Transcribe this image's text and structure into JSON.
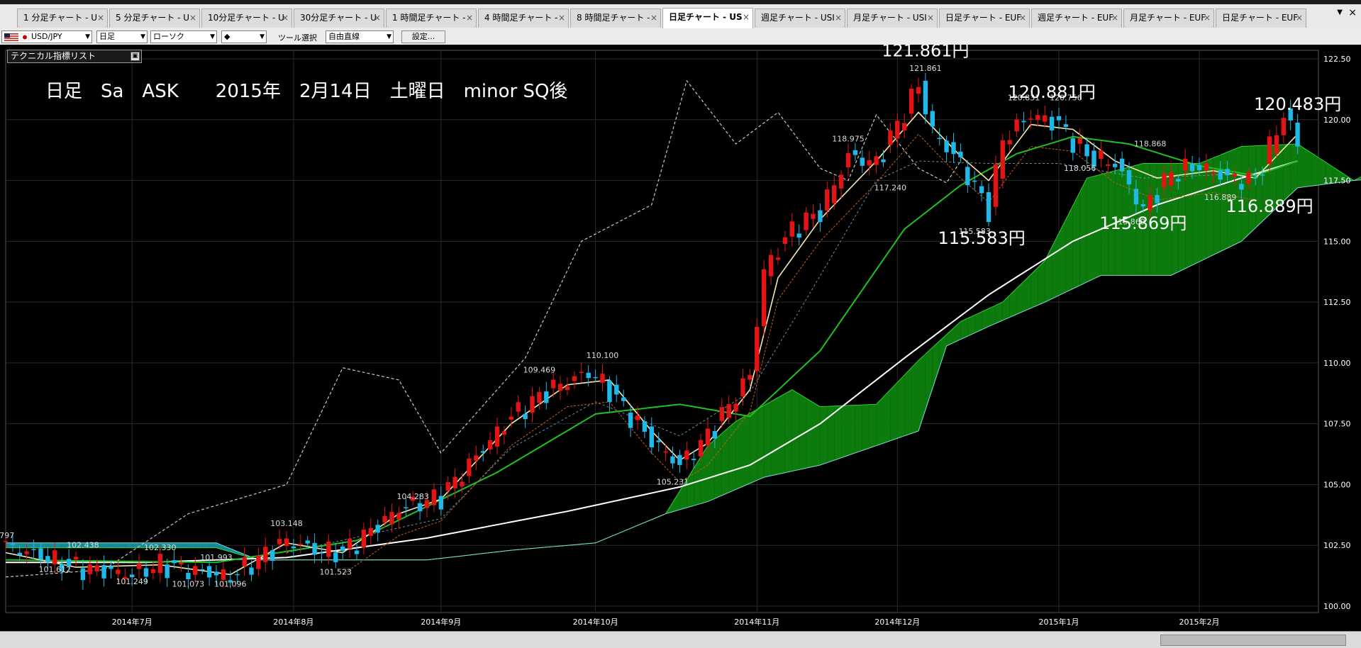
{
  "tabs": [
    {
      "label": "1 分足チャート - U"
    },
    {
      "label": "5 分足チャート - U"
    },
    {
      "label": "10分足チャート - U"
    },
    {
      "label": "30分足チャート - U"
    },
    {
      "label": "1 時間足チャート -"
    },
    {
      "label": "4 時間足チャート -"
    },
    {
      "label": "8 時間足チャート -"
    },
    {
      "label": "日足チャート - US",
      "active": true
    },
    {
      "label": "週足チャート - USI"
    },
    {
      "label": "月足チャート - USI"
    },
    {
      "label": "日足チャート - EUF"
    },
    {
      "label": "週足チャート - EUF"
    },
    {
      "label": "月足チャート - EUF"
    },
    {
      "label": "日足チャート - EUF"
    }
  ],
  "toolbar": {
    "pair": "USD/JPY",
    "timeframe": "日足",
    "chart_type": "ローソク",
    "line_style": "◆",
    "tool_label": "ツール選択",
    "tool_value": "自由直線",
    "settings_label": "設定..."
  },
  "indicator_list_label": "テクニカル指標リスト",
  "headline": "日足　Sa　ASK　　2015年　2月14日　土曜日　minor SQ後",
  "colors": {
    "background": "#000000",
    "bull_candle": "#e31414",
    "bear_candle": "#1fb8e8",
    "cloud_green": "#0d7a0d",
    "cloud_teal": "#138c98",
    "ma_white": "#ffffff",
    "ma_green": "#1ec21e",
    "ma_cream": "#f4e8b4",
    "chikou_gray": "#c8c8c8"
  },
  "chart_data": {
    "type": "candlestick",
    "title": "",
    "xlabel": "",
    "ylabel": "",
    "ylim": [
      100.0,
      122.5
    ],
    "yticks": [
      "122.50",
      "120.00",
      "117.50",
      "115.00",
      "112.50",
      "110.00",
      "107.50",
      "105.00",
      "102.50",
      "100.00"
    ],
    "x_month_labels": [
      {
        "label": "2014年7月",
        "i": 18
      },
      {
        "label": "2014年8月",
        "i": 41
      },
      {
        "label": "2014年9月",
        "i": 62
      },
      {
        "label": "2014年10月",
        "i": 84
      },
      {
        "label": "2014年11月",
        "i": 107
      },
      {
        "label": "2014年12月",
        "i": 127
      },
      {
        "label": "2015年1月",
        "i": 150
      },
      {
        "label": "2015年2月",
        "i": 170
      }
    ],
    "candles_anchor": [
      {
        "i": 0,
        "c": 102.5
      },
      {
        "i": 10,
        "c": 101.6
      },
      {
        "i": 18,
        "c": 101.3
      },
      {
        "i": 22,
        "c": 101.7
      },
      {
        "i": 32,
        "c": 101.2
      },
      {
        "i": 40,
        "c": 102.7
      },
      {
        "i": 44,
        "c": 102.3
      },
      {
        "i": 48,
        "c": 102.2
      },
      {
        "i": 56,
        "c": 104.0
      },
      {
        "i": 62,
        "c": 104.5
      },
      {
        "i": 72,
        "c": 107.8
      },
      {
        "i": 78,
        "c": 109.0
      },
      {
        "i": 83,
        "c": 109.6
      },
      {
        "i": 85,
        "c": 109.2
      },
      {
        "i": 92,
        "c": 106.8
      },
      {
        "i": 96,
        "c": 105.8
      },
      {
        "i": 100,
        "c": 107.0
      },
      {
        "i": 106,
        "c": 109.5
      },
      {
        "i": 108,
        "c": 113.8
      },
      {
        "i": 112,
        "c": 115.5
      },
      {
        "i": 116,
        "c": 116.2
      },
      {
        "i": 120,
        "c": 118.5
      },
      {
        "i": 124,
        "c": 118.2
      },
      {
        "i": 130,
        "c": 121.4
      },
      {
        "i": 132,
        "c": 119.5
      },
      {
        "i": 136,
        "c": 118.2
      },
      {
        "i": 140,
        "c": 116.3
      },
      {
        "i": 142,
        "c": 119.2
      },
      {
        "i": 146,
        "c": 120.2
      },
      {
        "i": 150,
        "c": 119.8
      },
      {
        "i": 154,
        "c": 118.5
      },
      {
        "i": 158,
        "c": 118.2
      },
      {
        "i": 162,
        "c": 116.3
      },
      {
        "i": 166,
        "c": 117.8
      },
      {
        "i": 170,
        "c": 118.1
      },
      {
        "i": 174,
        "c": 117.6
      },
      {
        "i": 178,
        "c": 117.5
      },
      {
        "i": 181,
        "c": 119.5
      },
      {
        "i": 182,
        "c": 120.3
      },
      {
        "i": 184,
        "c": 119.0
      }
    ],
    "ma_white_anchor": [
      {
        "i": 0,
        "v": 101.8
      },
      {
        "i": 20,
        "v": 101.8
      },
      {
        "i": 40,
        "v": 102.0
      },
      {
        "i": 60,
        "v": 102.8
      },
      {
        "i": 80,
        "v": 103.9
      },
      {
        "i": 96,
        "v": 104.9
      },
      {
        "i": 106,
        "v": 105.8
      },
      {
        "i": 116,
        "v": 107.5
      },
      {
        "i": 128,
        "v": 110.2
      },
      {
        "i": 140,
        "v": 112.8
      },
      {
        "i": 152,
        "v": 115.0
      },
      {
        "i": 164,
        "v": 116.5
      },
      {
        "i": 176,
        "v": 117.6
      },
      {
        "i": 184,
        "v": 118.3
      }
    ],
    "ma_green_anchor": [
      {
        "i": 0,
        "v": 101.9
      },
      {
        "i": 30,
        "v": 101.8
      },
      {
        "i": 50,
        "v": 102.7
      },
      {
        "i": 70,
        "v": 105.5
      },
      {
        "i": 84,
        "v": 107.9
      },
      {
        "i": 96,
        "v": 108.3
      },
      {
        "i": 106,
        "v": 107.8
      },
      {
        "i": 116,
        "v": 110.5
      },
      {
        "i": 128,
        "v": 115.5
      },
      {
        "i": 136,
        "v": 117.3
      },
      {
        "i": 144,
        "v": 118.6
      },
      {
        "i": 152,
        "v": 119.3
      },
      {
        "i": 160,
        "v": 119.0
      },
      {
        "i": 170,
        "v": 118.1
      },
      {
        "i": 178,
        "v": 117.7
      },
      {
        "i": 184,
        "v": 118.3
      }
    ],
    "ma_cream_anchor": [
      {
        "i": 0,
        "v": 102.2
      },
      {
        "i": 10,
        "v": 101.6
      },
      {
        "i": 22,
        "v": 101.7
      },
      {
        "i": 32,
        "v": 101.3
      },
      {
        "i": 40,
        "v": 102.6
      },
      {
        "i": 48,
        "v": 102.2
      },
      {
        "i": 56,
        "v": 103.8
      },
      {
        "i": 62,
        "v": 104.4
      },
      {
        "i": 72,
        "v": 107.5
      },
      {
        "i": 80,
        "v": 109.1
      },
      {
        "i": 86,
        "v": 109.3
      },
      {
        "i": 92,
        "v": 107.2
      },
      {
        "i": 96,
        "v": 106.0
      },
      {
        "i": 100,
        "v": 106.7
      },
      {
        "i": 106,
        "v": 108.9
      },
      {
        "i": 110,
        "v": 113.5
      },
      {
        "i": 116,
        "v": 115.9
      },
      {
        "i": 124,
        "v": 118.3
      },
      {
        "i": 130,
        "v": 120.3
      },
      {
        "i": 136,
        "v": 118.5
      },
      {
        "i": 140,
        "v": 117.5
      },
      {
        "i": 146,
        "v": 119.8
      },
      {
        "i": 152,
        "v": 119.6
      },
      {
        "i": 158,
        "v": 118.3
      },
      {
        "i": 164,
        "v": 117.6
      },
      {
        "i": 172,
        "v": 117.9
      },
      {
        "i": 178,
        "v": 117.6
      },
      {
        "i": 184,
        "v": 119.4
      }
    ],
    "chikou_anchor": [
      {
        "i": 0,
        "v": 101.2
      },
      {
        "i": 14,
        "v": 101.5
      },
      {
        "i": 26,
        "v": 103.8
      },
      {
        "i": 40,
        "v": 105.0
      },
      {
        "i": 48,
        "v": 109.8
      },
      {
        "i": 56,
        "v": 109.3
      },
      {
        "i": 62,
        "v": 106.3
      },
      {
        "i": 74,
        "v": 110.2
      },
      {
        "i": 82,
        "v": 115.0
      },
      {
        "i": 92,
        "v": 116.5
      },
      {
        "i": 97,
        "v": 121.6
      },
      {
        "i": 104,
        "v": 119.0
      },
      {
        "i": 110,
        "v": 120.3
      },
      {
        "i": 116,
        "v": 118.0
      },
      {
        "i": 120,
        "v": 117.5
      },
      {
        "i": 124,
        "v": 120.2
      },
      {
        "i": 130,
        "v": 118.0
      },
      {
        "i": 134,
        "v": 117.4
      },
      {
        "i": 136,
        "v": 118.3
      }
    ],
    "kijun_anchor": [
      {
        "i": 40,
        "v": 102.2
      },
      {
        "i": 62,
        "v": 103.6
      },
      {
        "i": 72,
        "v": 106.5
      },
      {
        "i": 84,
        "v": 108.4
      },
      {
        "i": 96,
        "v": 107.0
      },
      {
        "i": 106,
        "v": 108.8
      },
      {
        "i": 114,
        "v": 112.6
      },
      {
        "i": 124,
        "v": 117.5
      },
      {
        "i": 130,
        "v": 118.3
      },
      {
        "i": 140,
        "v": 118.2
      },
      {
        "i": 150,
        "v": 118.2
      },
      {
        "i": 162,
        "v": 117.6
      },
      {
        "i": 178,
        "v": 117.8
      }
    ],
    "cloud_a_anchor": [
      {
        "i": 0,
        "v": 102.4
      },
      {
        "i": 30,
        "v": 102.4
      },
      {
        "i": 36,
        "v": 101.9
      },
      {
        "i": 60,
        "v": 101.9
      },
      {
        "i": 72,
        "v": 102.3
      },
      {
        "i": 84,
        "v": 102.6
      },
      {
        "i": 94,
        "v": 103.8
      },
      {
        "i": 100,
        "v": 106.6
      },
      {
        "i": 104,
        "v": 107.6
      },
      {
        "i": 112,
        "v": 108.9
      },
      {
        "i": 116,
        "v": 108.2
      },
      {
        "i": 124,
        "v": 108.3
      },
      {
        "i": 130,
        "v": 110.1
      },
      {
        "i": 136,
        "v": 111.7
      },
      {
        "i": 142,
        "v": 112.5
      },
      {
        "i": 148,
        "v": 114.2
      },
      {
        "i": 154,
        "v": 117.6
      },
      {
        "i": 162,
        "v": 118.2
      },
      {
        "i": 170,
        "v": 118.2
      },
      {
        "i": 176,
        "v": 118.9
      },
      {
        "i": 184,
        "v": 119.0
      },
      {
        "i": 192,
        "v": 117.5
      },
      {
        "i": 200,
        "v": 118.6
      },
      {
        "i": 206,
        "v": 118.6
      }
    ],
    "cloud_b_anchor": [
      {
        "i": 0,
        "v": 102.6
      },
      {
        "i": 30,
        "v": 102.6
      },
      {
        "i": 36,
        "v": 101.9
      },
      {
        "i": 60,
        "v": 101.9
      },
      {
        "i": 72,
        "v": 102.3
      },
      {
        "i": 84,
        "v": 102.6
      },
      {
        "i": 94,
        "v": 103.8
      },
      {
        "i": 100,
        "v": 104.3
      },
      {
        "i": 108,
        "v": 105.3
      },
      {
        "i": 116,
        "v": 105.8
      },
      {
        "i": 124,
        "v": 106.6
      },
      {
        "i": 130,
        "v": 107.2
      },
      {
        "i": 134,
        "v": 110.7
      },
      {
        "i": 140,
        "v": 111.5
      },
      {
        "i": 148,
        "v": 112.5
      },
      {
        "i": 156,
        "v": 113.6
      },
      {
        "i": 166,
        "v": 113.6
      },
      {
        "i": 176,
        "v": 115.0
      },
      {
        "i": 184,
        "v": 117.2
      },
      {
        "i": 192,
        "v": 117.5
      },
      {
        "i": 200,
        "v": 117.7
      },
      {
        "i": 206,
        "v": 118.0
      }
    ],
    "data_labels": [
      {
        "text": ".797",
        "i": 0,
        "v": 102.8
      },
      {
        "text": "102.438",
        "i": 11,
        "v": 102.4
      },
      {
        "text": "101.612",
        "i": 7,
        "v": 101.4
      },
      {
        "text": "102.330",
        "i": 22,
        "v": 102.3
      },
      {
        "text": "101.249",
        "i": 18,
        "v": 100.9
      },
      {
        "text": "101.993",
        "i": 30,
        "v": 101.9
      },
      {
        "text": "101.073",
        "i": 26,
        "v": 100.8
      },
      {
        "text": "101.096",
        "i": 32,
        "v": 100.8
      },
      {
        "text": "103.148",
        "i": 40,
        "v": 103.3
      },
      {
        "text": "101.523",
        "i": 47,
        "v": 101.3
      },
      {
        "text": "104.283",
        "i": 58,
        "v": 104.4
      },
      {
        "text": "109.469",
        "i": 76,
        "v": 109.6
      },
      {
        "text": "110.100",
        "i": 85,
        "v": 110.2
      },
      {
        "text": "105.231",
        "i": 95,
        "v": 105.0
      },
      {
        "text": "118.975",
        "i": 120,
        "v": 119.1
      },
      {
        "text": "117.240",
        "i": 126,
        "v": 117.1
      },
      {
        "text": "121.861",
        "i": 131,
        "v": 122.0
      },
      {
        "text": "115.583",
        "i": 138,
        "v": 115.3
      },
      {
        "text": "120.831",
        "i": 145,
        "v": 120.8
      },
      {
        "text": "120.756",
        "i": 151,
        "v": 120.8
      },
      {
        "text": "118.056",
        "i": 153,
        "v": 117.9
      },
      {
        "text": "118.868",
        "i": 163,
        "v": 118.9
      },
      {
        "text": "115.869",
        "i": 160,
        "v": 115.7
      },
      {
        "text": "116.889",
        "i": 173,
        "v": 116.7
      }
    ],
    "annotations": [
      {
        "text": "121.861円",
        "i": 131,
        "v": 122.6
      },
      {
        "text": "120.881円",
        "i": 149,
        "v": 120.9
      },
      {
        "text": "120.483円",
        "i": 184,
        "v": 120.4
      },
      {
        "text": "115.583円",
        "i": 139,
        "v": 114.9
      },
      {
        "text": "115.869円",
        "i": 162,
        "v": 115.5
      },
      {
        "text": "116.889円",
        "i": 180,
        "v": 116.2
      }
    ]
  }
}
